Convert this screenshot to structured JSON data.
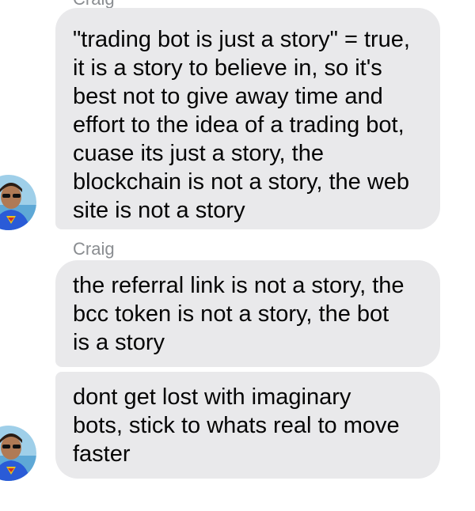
{
  "conversation": {
    "sender_top": "Craig",
    "sender_mid": "Craig",
    "messages": [
      {
        "text": "\"trading bot is just a story\" = true,\nit is a story to believe in, so it's\nbest not to give away time and\neffort to the idea of a trading bot,\ncuase its just a story, the\nblockchain is not a story, the web\nsite is not a story"
      },
      {
        "text": "the referral link is not a story, the\nbcc token is not a story, the bot\nis a story"
      },
      {
        "text": "dont get lost with imaginary\nbots, stick to whats real to move\nfaster"
      }
    ]
  },
  "colors": {
    "bubble": "#e9e9eb",
    "text": "#050505",
    "sender_name": "#8a8d91",
    "avatar_shirt": "#2a5bd7",
    "avatar_emblem": "#e8c21a"
  },
  "icons": {
    "avatar": "profile-photo-avatar"
  }
}
